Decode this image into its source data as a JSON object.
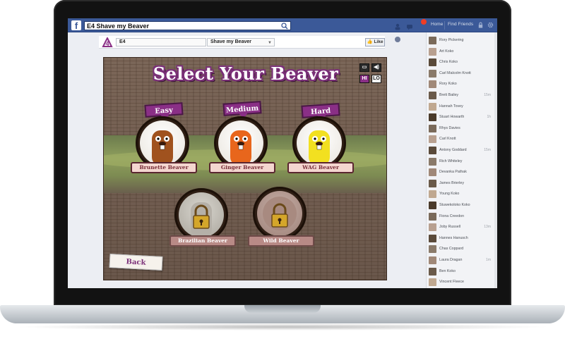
{
  "facebook": {
    "logo": "f",
    "search_value": "E4 Shave my Beaver",
    "nav": {
      "home": "Home",
      "find_friends": "Find Friends"
    },
    "notification_count": "1"
  },
  "app": {
    "logo": "E4 logo",
    "name_field": "E4",
    "title_select": "Shave my Beaver",
    "like_label": "Like"
  },
  "game": {
    "title": "Select Your Beaver",
    "controls": {
      "hi": "HI",
      "lo": "LO"
    },
    "levels": [
      {
        "tag": "Easy",
        "name": "Brunette Beaver",
        "color": "#a0521e"
      },
      {
        "tag": "Medium",
        "name": "Ginger Beaver",
        "color": "#e8661c"
      },
      {
        "tag": "Hard",
        "name": "WAG Beaver",
        "color": "#f2e020"
      }
    ],
    "locked": [
      {
        "name": "Brazilian Beaver"
      },
      {
        "name": "Wild Beaver"
      }
    ],
    "back_label": "Back"
  },
  "friends": [
    {
      "name": "Rory Pickering",
      "status": ""
    },
    {
      "name": "Art Koko",
      "status": ""
    },
    {
      "name": "Chris Koko",
      "status": ""
    },
    {
      "name": "Carl Malcolm Knott",
      "status": ""
    },
    {
      "name": "Rory Koko",
      "status": ""
    },
    {
      "name": "Brett Bailey",
      "status": "15m"
    },
    {
      "name": "Hannah Tovey",
      "status": ""
    },
    {
      "name": "Stuart Howarth",
      "status": "1h"
    },
    {
      "name": "Rhys Davies",
      "status": ""
    },
    {
      "name": "Carl Knott",
      "status": ""
    },
    {
      "name": "Antony Goddard",
      "status": "15m"
    },
    {
      "name": "Rich Whiteley",
      "status": ""
    },
    {
      "name": "Devanka Pathak",
      "status": ""
    },
    {
      "name": "James Brierley",
      "status": ""
    },
    {
      "name": "Young Koko",
      "status": ""
    },
    {
      "name": "Stuwekoloko Koko",
      "status": ""
    },
    {
      "name": "Fiona Creedon",
      "status": ""
    },
    {
      "name": "Joby Russell",
      "status": "13m"
    },
    {
      "name": "Hannes Hanusch",
      "status": ""
    },
    {
      "name": "Chas Coppard",
      "status": ""
    },
    {
      "name": "Laura Dragan",
      "status": "1m"
    },
    {
      "name": "Ben Koko",
      "status": ""
    },
    {
      "name": "Vincent Fleece",
      "status": ""
    }
  ]
}
